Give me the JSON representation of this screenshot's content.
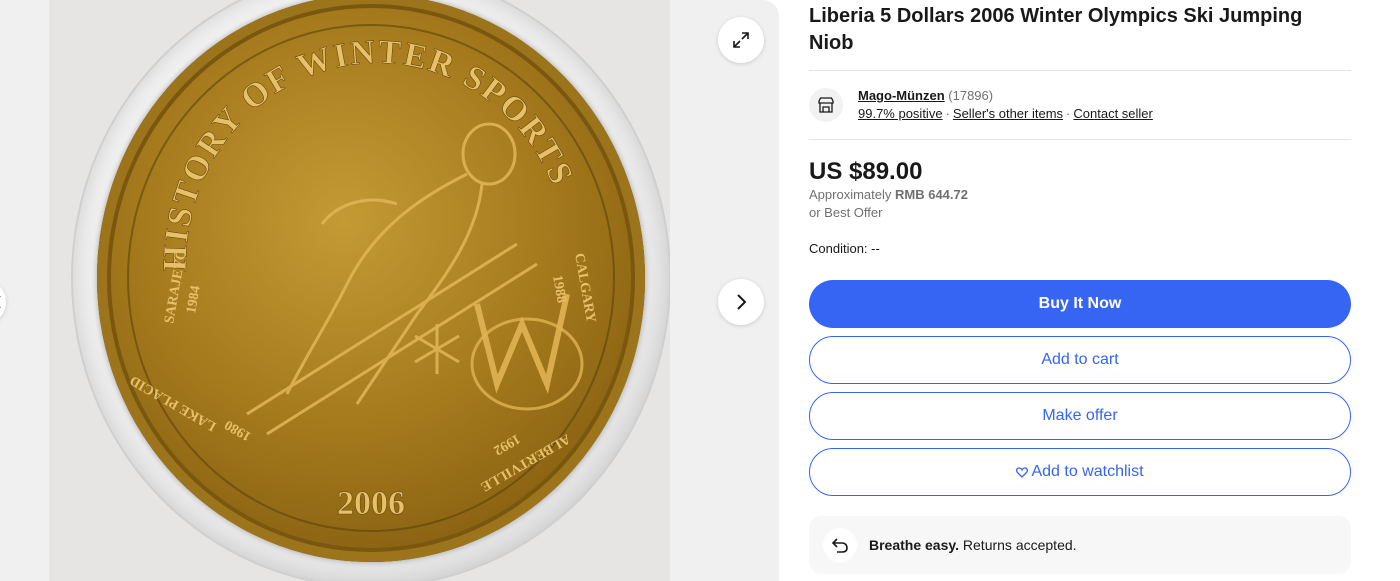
{
  "gallery": {
    "coin_text": {
      "top_arc": "HISTORY OF WINTER SPORTS",
      "year": "2006",
      "left_city": "SARAJEVO",
      "left_year": "1984",
      "right_city": "CALGARY",
      "right_year": "1988",
      "bottom_left_city": "LAKE PLACID",
      "bottom_left_year": "1980",
      "bottom_right_city": "ALBERTVILLE",
      "bottom_right_year": "1992"
    },
    "expand_icon": "expand-icon",
    "next_icon": "chevron-right-icon",
    "prev_icon": "chevron-left-icon"
  },
  "listing": {
    "title": "Liberia 5 Dollars 2006 Winter Olympics Ski Jumping Niob"
  },
  "seller": {
    "icon": "store-icon",
    "name": "Mago-Münzen",
    "feedback_count": "(17896)",
    "positive": "99.7% positive",
    "other_items": "Seller's other items",
    "contact": "Contact seller",
    "separator": "·"
  },
  "pricing": {
    "price": "US $89.00",
    "approx_label": "Approximately",
    "approx_value": "RMB 644.72",
    "best_offer": "or Best Offer"
  },
  "condition": {
    "label": "Condition:",
    "value": "--"
  },
  "actions": {
    "buy_now": "Buy It Now",
    "add_to_cart": "Add to cart",
    "make_offer": "Make offer",
    "watchlist": "Add to watchlist"
  },
  "returns": {
    "icon": "return-arrow-icon",
    "bold": "Breathe easy.",
    "text": "Returns accepted."
  },
  "colors": {
    "primary": "#3665f3",
    "text": "#191919",
    "muted": "#707070",
    "coin_gold": "#a57a1d"
  }
}
